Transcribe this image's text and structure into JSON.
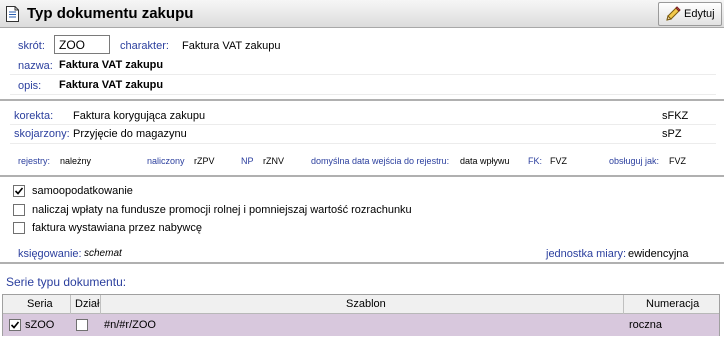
{
  "header": {
    "title": "Typ dokumentu zakupu",
    "edit_label": "Edytuj"
  },
  "general": {
    "skrot_label": "skrót:",
    "skrot_value": "ZOO",
    "charakter_label": "charakter:",
    "charakter_value": "Faktura VAT zakupu",
    "nazwa_label": "nazwa:",
    "nazwa_value": "Faktura VAT zakupu",
    "opis_label": "opis:",
    "opis_value": "Faktura VAT zakupu"
  },
  "links": {
    "korekta_label": "korekta:",
    "korekta_value": "Faktura korygująca zakupu",
    "korekta_code": "sFKZ",
    "skojarzony_label": "skojarzony:",
    "skojarzony_value": "Przyjęcie do magazynu",
    "skojarzony_code": "sPZ"
  },
  "registers": {
    "rejestry_label": "rejestry:",
    "rejestry_value": "należny",
    "naliczony_label": "naliczony",
    "naliczony_value": "rZPV",
    "np_label": "NP",
    "np_value": "rZNV",
    "domyslna_label": "domyślna data wejścia do rejestru:",
    "domyslna_value": "data wpływu",
    "fk_label": "FK:",
    "fk_value": "FVZ",
    "obsluguj_label": "obsługuj jak:",
    "obsluguj_value": "FVZ"
  },
  "options": {
    "samoopodatkowanie": "samoopodatkowanie",
    "naliczaj": "naliczaj wpłaty na fundusze promocji rolnej i pomniejszaj wartość rozrachunku",
    "faktura_nabywcy": "faktura wystawiana przez nabywcę",
    "checked": [
      true,
      false,
      false
    ]
  },
  "accounting": {
    "ksiegowanie_label": "księgowanie:",
    "ksiegowanie_value": "schemat",
    "jednostka_label": "jednostka miary:",
    "jednostka_value": "ewidencyjna"
  },
  "series": {
    "section_title": "Serie typu dokumentu:",
    "columns": [
      "Seria",
      "Dział",
      "Szablon",
      "Numeracja"
    ],
    "rows": [
      {
        "seria": "sZOO",
        "dzial": "",
        "szablon": "#n/#r/ZOO",
        "numeracja": "roczna",
        "selected": true,
        "dzial_checked": false
      }
    ]
  },
  "colors": {
    "label_blue": "#2b3f9e",
    "row_highlight": "#d8c8dd"
  }
}
